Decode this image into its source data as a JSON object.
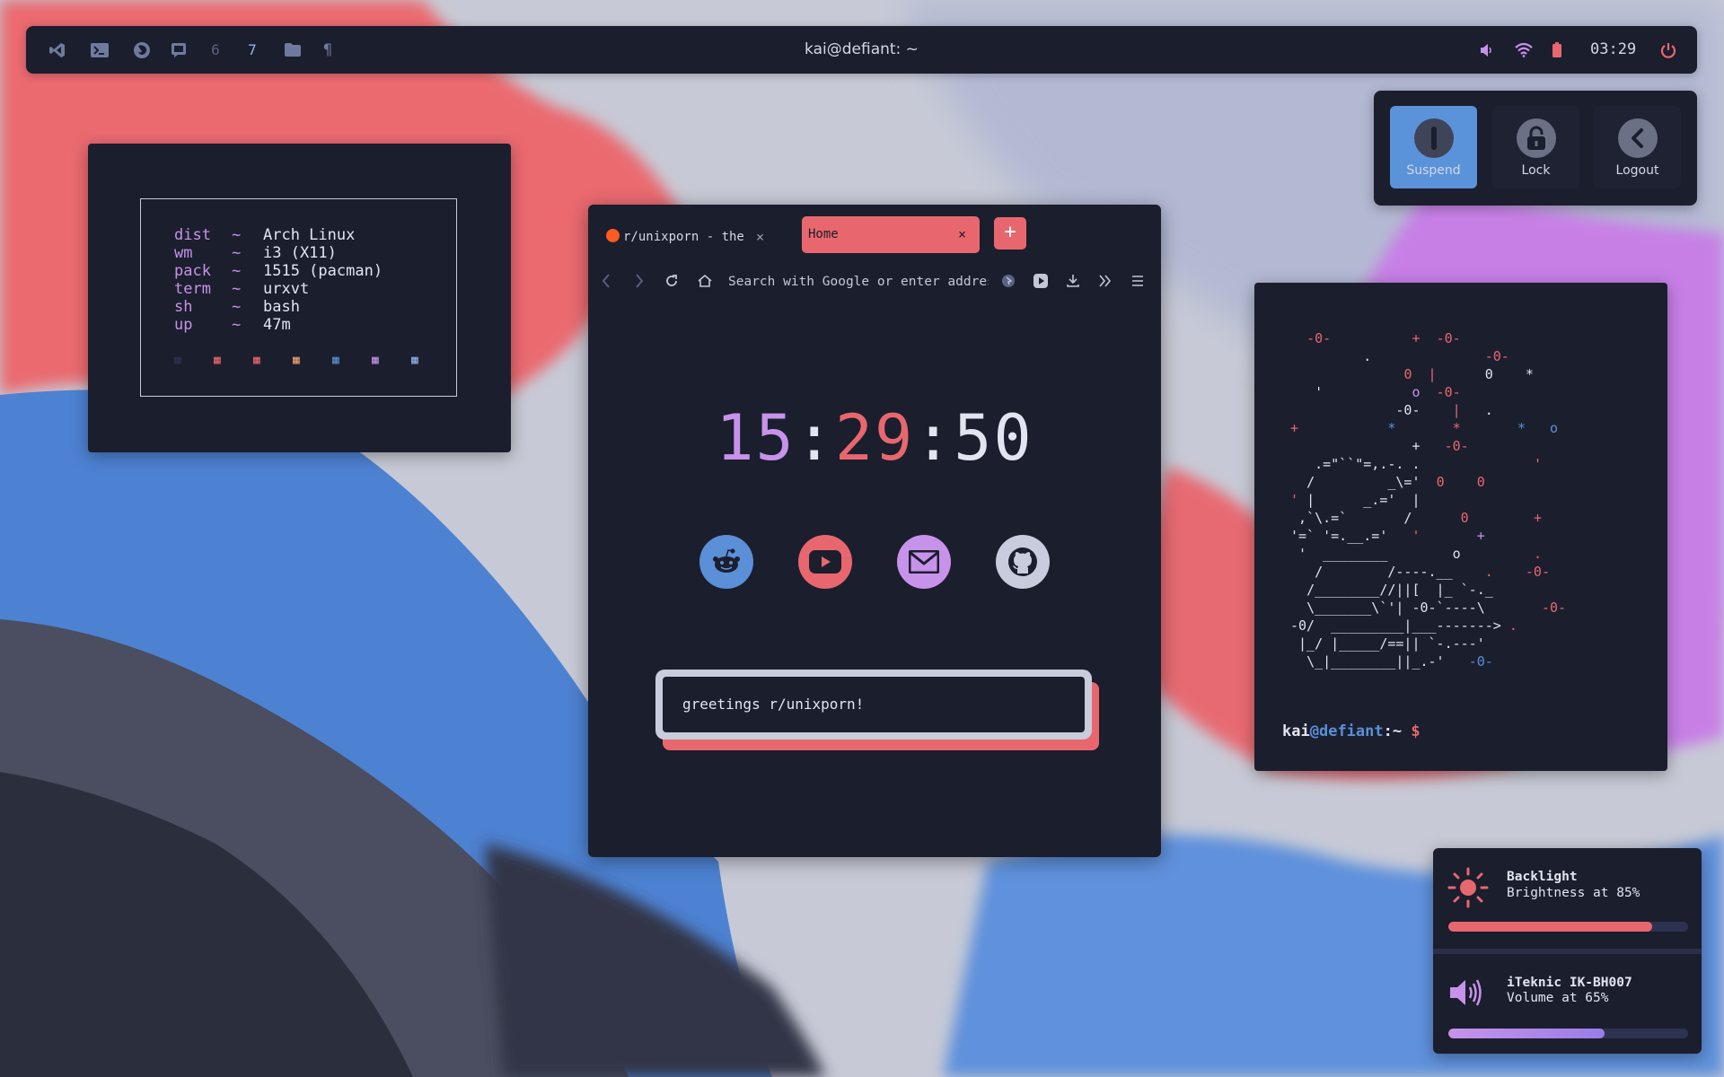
{
  "topbar": {
    "title": "kai@defiant: ~",
    "clock": "03:29",
    "workspaces": [
      "6",
      "7"
    ],
    "left_icons": [
      "vscode-icon",
      "terminal-icon",
      "firefox-icon",
      "chat-icon",
      "folder-icon",
      "pilcrow-icon"
    ],
    "right_icons": [
      "volume-icon",
      "wifi-icon",
      "battery-icon",
      "power-icon"
    ]
  },
  "power_menu": {
    "buttons": [
      {
        "label": "Suspend",
        "icon": "suspend-icon"
      },
      {
        "label": "Lock",
        "icon": "lock-icon"
      },
      {
        "label": "Logout",
        "icon": "logout-icon"
      }
    ]
  },
  "sysinfo": {
    "separator": "~",
    "rows": [
      {
        "key": "dist",
        "value": "Arch Linux"
      },
      {
        "key": "wm",
        "value": "i3 (X11)"
      },
      {
        "key": "pack",
        "value": "1515 (pacman)"
      },
      {
        "key": "term",
        "value": "urxvt"
      },
      {
        "key": "sh",
        "value": "bash"
      },
      {
        "key": "up",
        "value": "47m"
      }
    ],
    "swatch_glyph": "▦",
    "swatch_colors": [
      "#2d3250",
      "#e8676f",
      "#e8676f",
      "#f0a070",
      "#5b8fd8",
      "#c792ea",
      "#8fb4e8"
    ]
  },
  "browser": {
    "tabs": [
      {
        "label": "r/unixporn - the",
        "close": "×"
      },
      {
        "label": "Home",
        "close": "×"
      }
    ],
    "new_tab": "+",
    "url_placeholder": "Search with Google or enter addres",
    "clock": {
      "hours": "15",
      "minutes": "29",
      "seconds": "50",
      "separator": ":"
    },
    "shortcuts": [
      "reddit-icon",
      "youtube-icon",
      "mail-icon",
      "github-icon"
    ],
    "greeting": "greetings r/unixporn!"
  },
  "terminal": {
    "prompt_user": "kai",
    "prompt_at": "@",
    "prompt_host": "defiant",
    "prompt_path": ":~",
    "prompt_symbol": " $"
  },
  "osd": {
    "backlight": {
      "title": "Backlight",
      "subtitle": "Brightness at 85%",
      "level": 0.85
    },
    "volume": {
      "title": "iTeknic IK-BH007",
      "subtitle": "Volume at 65%",
      "level": 0.65
    }
  },
  "colors": {
    "bg": "#1b1e2d",
    "red": "#e8676f",
    "purple": "#c792ea",
    "blue": "#5b8fd8",
    "text": "#e2e5f0"
  }
}
